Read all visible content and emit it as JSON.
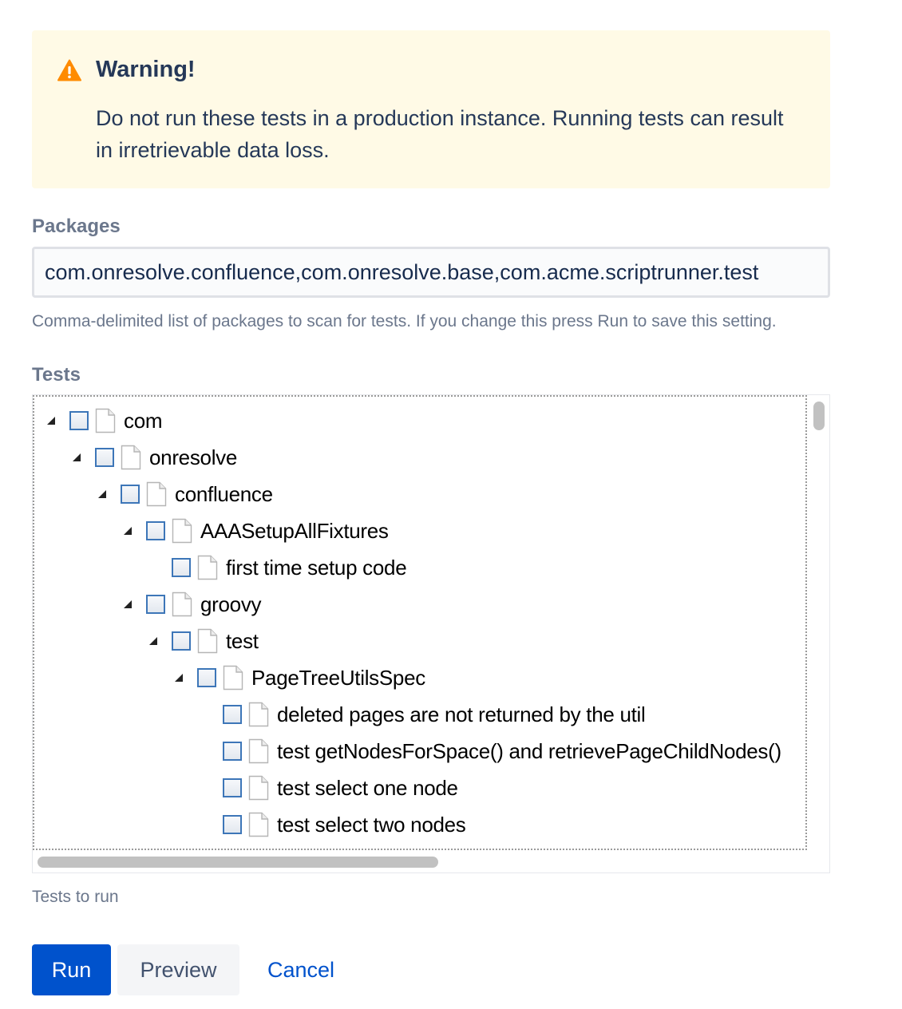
{
  "warning": {
    "title": "Warning!",
    "body": "Do not run these tests in a production instance. Running tests can result in irretrievable data loss.",
    "icon": "warning-triangle-icon",
    "icon_color": "#ff8b00",
    "background": "#fffae6"
  },
  "packages": {
    "label": "Packages",
    "value": "com.onresolve.confluence,com.onresolve.base,com.acme.scriptrunner.test",
    "help": "Comma-delimited list of packages to scan for tests. If you change this press Run to save this setting."
  },
  "tests": {
    "label": "Tests",
    "help": "Tests to run",
    "tree": [
      {
        "label": "com",
        "expanded": true,
        "checked": false
      },
      {
        "label": "onresolve",
        "expanded": true,
        "checked": false
      },
      {
        "label": "confluence",
        "expanded": true,
        "checked": false
      },
      {
        "label": "AAASetupAllFixtures",
        "expanded": true,
        "checked": false
      },
      {
        "label": "first time setup code",
        "leaf": true,
        "checked": false
      },
      {
        "label": "groovy",
        "expanded": true,
        "checked": false
      },
      {
        "label": "test",
        "expanded": true,
        "checked": false
      },
      {
        "label": "PageTreeUtilsSpec",
        "expanded": true,
        "checked": false
      },
      {
        "label": "deleted pages are not returned by the util",
        "leaf": true,
        "checked": false
      },
      {
        "label": "test getNodesForSpace() and retrievePageChildNodes()",
        "leaf": true,
        "checked": false
      },
      {
        "label": "test select one node",
        "leaf": true,
        "checked": false
      },
      {
        "label": "test select two nodes",
        "leaf": true,
        "checked": false
      }
    ]
  },
  "buttons": {
    "run": "Run",
    "preview": "Preview",
    "cancel": "Cancel"
  },
  "colors": {
    "primary": "#0052cc",
    "checkbox_border": "#3d76b8"
  }
}
